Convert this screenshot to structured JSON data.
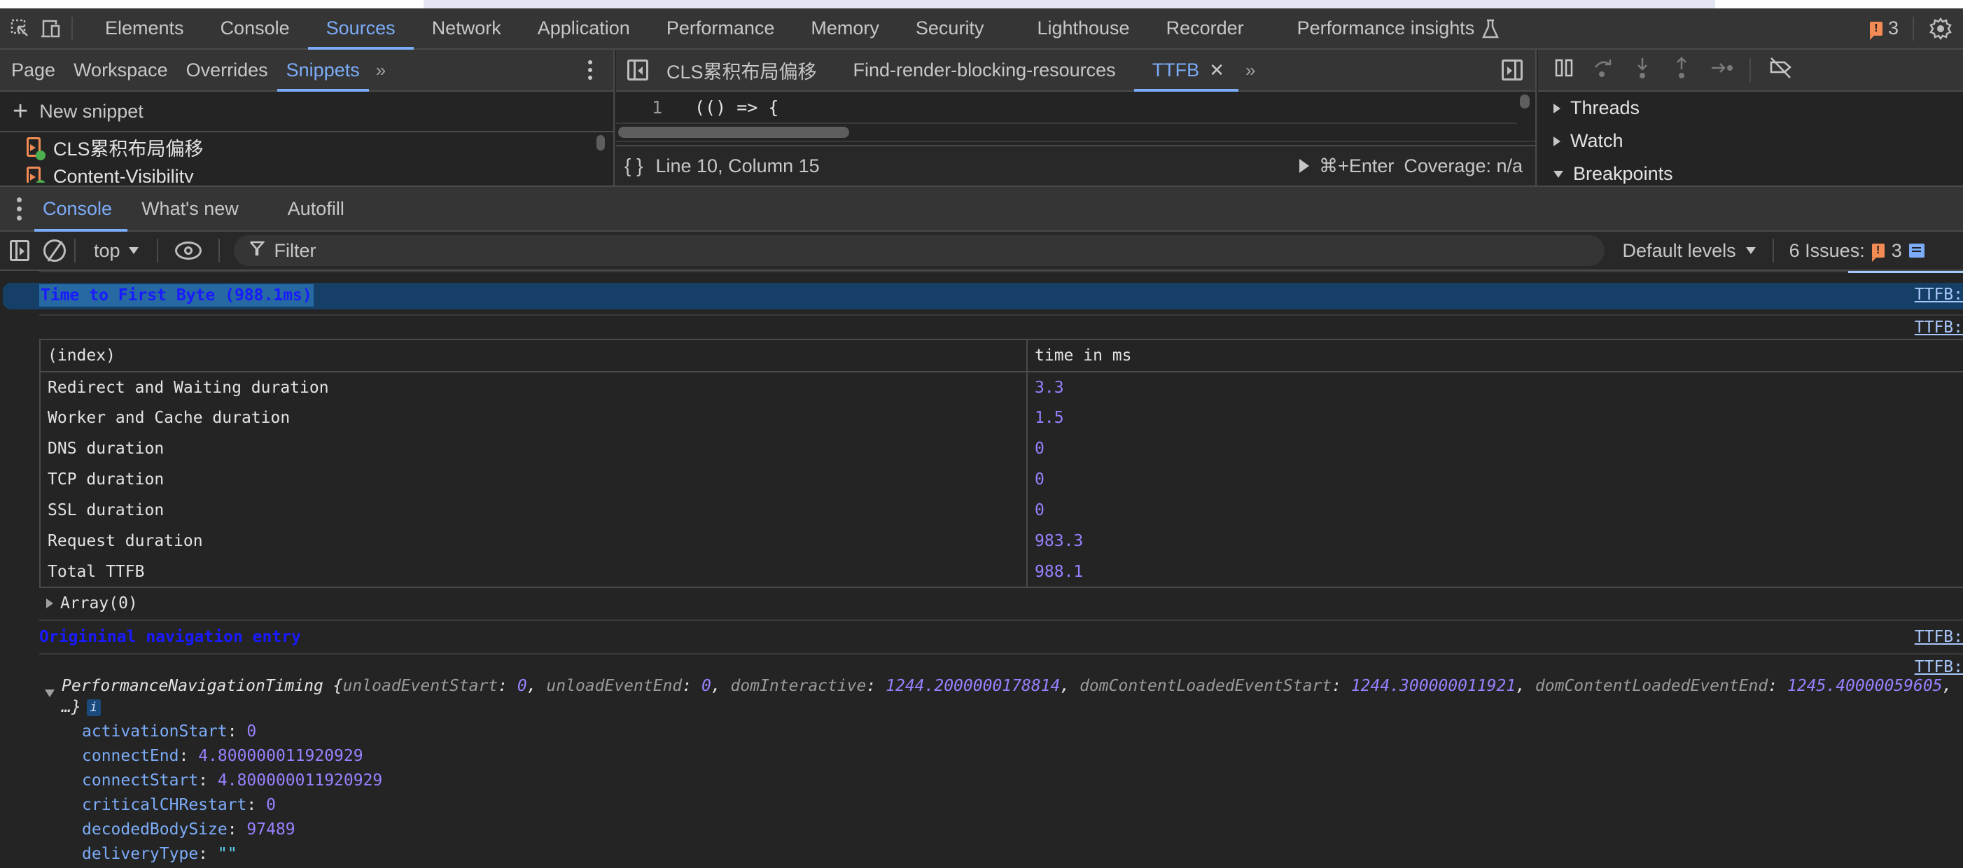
{
  "main_tabs": {
    "items": [
      {
        "label": "Elements",
        "active": false
      },
      {
        "label": "Console",
        "active": false
      },
      {
        "label": "Sources",
        "active": true
      },
      {
        "label": "Network",
        "active": false
      },
      {
        "label": "Application",
        "active": false
      },
      {
        "label": "Performance",
        "active": false
      },
      {
        "label": "Memory",
        "active": false
      },
      {
        "label": "Security",
        "active": false
      },
      {
        "label": "Lighthouse",
        "active": false
      },
      {
        "label": "Recorder",
        "active": false
      },
      {
        "label": "Performance insights",
        "active": false
      }
    ],
    "issues_count": "3"
  },
  "sources": {
    "nav_tabs": [
      {
        "label": "Page",
        "active": false
      },
      {
        "label": "Workspace",
        "active": false
      },
      {
        "label": "Overrides",
        "active": false
      },
      {
        "label": "Snippets",
        "active": true
      }
    ],
    "new_snippet_label": "New snippet",
    "snippets": [
      {
        "name": "CLS累积布局偏移"
      },
      {
        "name": "Content-Visibility"
      }
    ],
    "editor_tabs": [
      {
        "label": "CLS累积布局偏移",
        "active": false
      },
      {
        "label": "Find-render-blocking-resources",
        "active": false
      },
      {
        "label": "TTFB",
        "active": true
      }
    ],
    "code_lines": [
      {
        "number": "1",
        "text": "(() => {"
      }
    ],
    "status": {
      "cursor": "Line 10, Column 15",
      "run_shortcut": "⌘+Enter",
      "coverage": "Coverage: n/a"
    },
    "debugger_sections": [
      {
        "label": "Threads",
        "expanded": false
      },
      {
        "label": "Watch",
        "expanded": false
      },
      {
        "label": "Breakpoints",
        "expanded": true
      }
    ]
  },
  "drawer": {
    "tabs": [
      {
        "label": "Console",
        "active": true
      },
      {
        "label": "What's new",
        "active": false
      },
      {
        "label": "Autofill",
        "active": false
      }
    ]
  },
  "console_toolbar": {
    "context": "top",
    "filter_placeholder": "Filter",
    "filter_value": "",
    "levels": "Default levels",
    "issues_label": "6 Issues:",
    "issues_warning_count": "3"
  },
  "console": {
    "source_link": "TTFB:",
    "selected_message": "Time to First Byte (988.1ms)",
    "table": {
      "headers": [
        "(index)",
        "time in ms"
      ],
      "rows": [
        {
          "index": "Redirect and Waiting duration",
          "value": "3.3"
        },
        {
          "index": "Worker and Cache duration",
          "value": "1.5"
        },
        {
          "index": "DNS duration",
          "value": "0"
        },
        {
          "index": "TCP duration",
          "value": "0"
        },
        {
          "index": "SSL duration",
          "value": "0"
        },
        {
          "index": "Request duration",
          "value": "983.3"
        },
        {
          "index": "Total TTFB",
          "value": "988.1"
        }
      ]
    },
    "array_label": "Array(0)",
    "nav_entry_message": "Origininal navigation entry",
    "object": {
      "class_name": "PerformanceNavigationTiming",
      "preview": [
        {
          "key": "unloadEventStart",
          "value": "0"
        },
        {
          "key": "unloadEventEnd",
          "value": "0"
        },
        {
          "key": "domInteractive",
          "value": "1244.2000000178814"
        },
        {
          "key": "domContentLoadedEventStart",
          "value": "1244.300000011921"
        },
        {
          "key": "domContentLoadedEventEnd",
          "value": "1245.40000059605"
        }
      ],
      "ellipsis": "…}",
      "properties": [
        {
          "key": "activationStart",
          "value": "0",
          "type": "number"
        },
        {
          "key": "connectEnd",
          "value": "4.800000011920929",
          "type": "number"
        },
        {
          "key": "connectStart",
          "value": "4.800000011920929",
          "type": "number"
        },
        {
          "key": "criticalCHRestart",
          "value": "0",
          "type": "number"
        },
        {
          "key": "decodedBodySize",
          "value": "97489",
          "type": "number"
        },
        {
          "key": "deliveryType",
          "value": "\"\"",
          "type": "string"
        }
      ]
    }
  }
}
